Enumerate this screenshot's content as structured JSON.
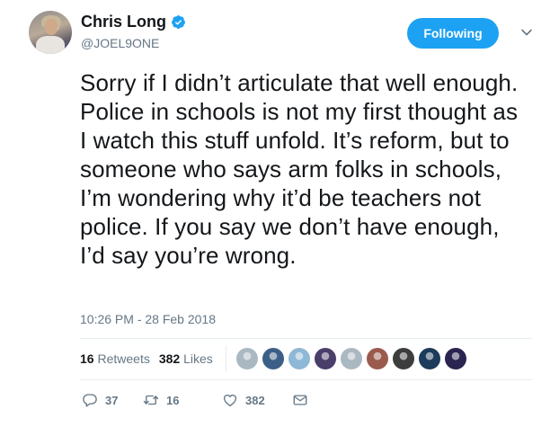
{
  "author": {
    "display_name": "Chris Long",
    "handle": "@JOEL9ONE",
    "verified_icon": "verified-badge-icon"
  },
  "follow_button": {
    "label": "Following",
    "color": "#1da1f2"
  },
  "tweet": {
    "text": "Sorry if I didn’t articulate that well enough. Police in schools is not my first thought as I watch this stuff unfold. It’s reform, but to someone who says arm folks in schools, I’m wondering why it’d be teachers not police. If you say we don’t have enough, I’d say you’re wrong.",
    "timestamp": "10:26 PM - 28 Feb 2018"
  },
  "stats": {
    "retweets_count": "16",
    "retweets_label": "Retweets",
    "likes_count": "382",
    "likes_label": "Likes"
  },
  "likers": [
    "#aab8c2",
    "#3b5f86",
    "#8fb7d6",
    "#4a3f6b",
    "#aab8c2",
    "#9a5b4e",
    "#3d3d3d",
    "#1d3b5a",
    "#2a2450"
  ],
  "actions": {
    "reply_count": "37",
    "retweet_count": "16",
    "like_count": "382"
  },
  "colors": {
    "accent": "#1da1f2",
    "muted": "#657786",
    "text": "#14171a"
  }
}
